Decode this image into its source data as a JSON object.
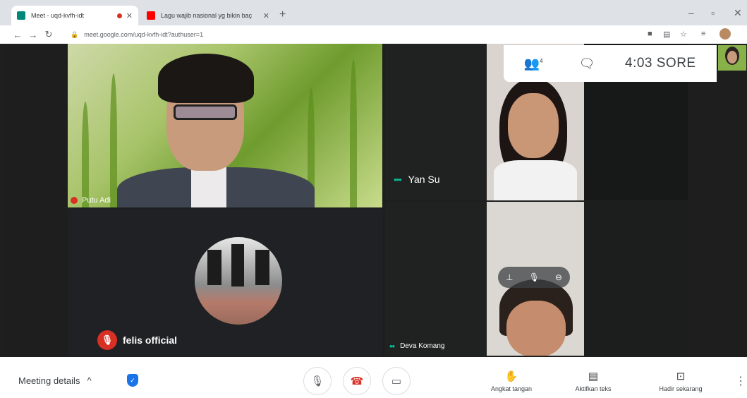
{
  "browser": {
    "tabs": [
      {
        "title": "Meet - uqd-kvfh-idt",
        "favicon_color": "#00897b",
        "recording": true
      },
      {
        "title": "Lagu wajib nasional yg bikin baç",
        "favicon_color": "#ff0000"
      }
    ],
    "new_tab": "+",
    "url": "meet.google.com/uqd-kvfh-idt?authuser=1",
    "window_controls": {
      "minimize": "–",
      "maximize": "▫",
      "close": "✕"
    }
  },
  "meet": {
    "participants": [
      {
        "name": "Putu Adi"
      },
      {
        "name": "felis official"
      },
      {
        "name": "Yan Su"
      },
      {
        "name": "Deva Komang"
      }
    ],
    "panel": {
      "people_count": "4",
      "time": "4:03 SORE"
    },
    "bottom": {
      "details_label": "Meeting details",
      "actions": [
        {
          "label": "Angkat tangan",
          "icon": "raise-hand-icon"
        },
        {
          "label": "Aktifkan teks",
          "icon": "captions-icon"
        },
        {
          "label": "Hadir sekarang",
          "icon": "present-icon"
        }
      ]
    }
  },
  "colors": {
    "accent": "#1a73e8",
    "danger": "#d93025",
    "speaking": "#00c29a"
  }
}
